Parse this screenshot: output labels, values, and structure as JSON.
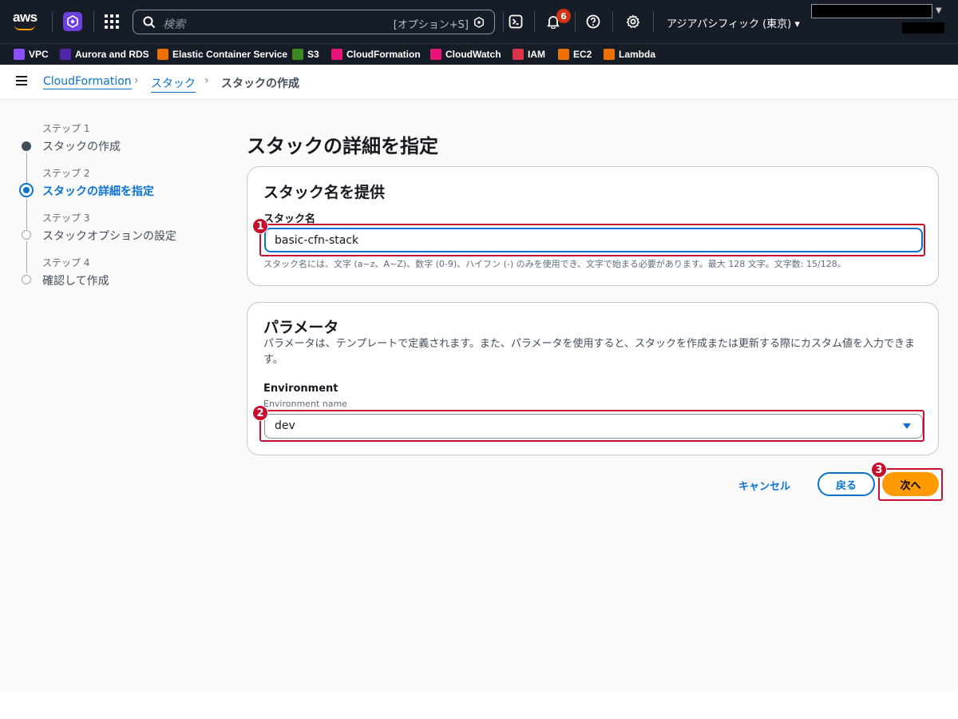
{
  "topbar": {
    "logo_text": "aws",
    "search_placeholder": "検索",
    "search_shortcut": "[オプション+S]",
    "notification_count": "6",
    "region": "アジアパシフィック (東京) ▾"
  },
  "favorites": [
    {
      "label": "VPC",
      "color": "#8c4fff"
    },
    {
      "label": "Aurora and RDS",
      "color": "#4d27a8"
    },
    {
      "label": "Elastic Container Service",
      "color": "#ed7100"
    },
    {
      "label": "S3",
      "color": "#3f8624"
    },
    {
      "label": "CloudFormation",
      "color": "#e7157b"
    },
    {
      "label": "CloudWatch",
      "color": "#e7157b"
    },
    {
      "label": "IAM",
      "color": "#dd344c"
    },
    {
      "label": "EC2",
      "color": "#ed7100"
    },
    {
      "label": "Lambda",
      "color": "#ed7100"
    }
  ],
  "breadcrumb": {
    "items": [
      "CloudFormation",
      "スタック",
      "スタックの作成"
    ]
  },
  "steps": [
    {
      "label": "ステップ 1",
      "title": "スタックの作成",
      "state": "done"
    },
    {
      "label": "ステップ 2",
      "title": "スタックの詳細を指定",
      "state": "active"
    },
    {
      "label": "ステップ 3",
      "title": "スタックオプションの設定",
      "state": "todo"
    },
    {
      "label": "ステップ 4",
      "title": "確認して作成",
      "state": "todo"
    }
  ],
  "page_title": "スタックの詳細を指定",
  "stack_name_card": {
    "heading": "スタック名を提供",
    "field_label": "スタック名",
    "value": "basic-cfn-stack",
    "help": "スタック名には、文字 (a~z、A~Z)、数字 (0-9)、ハイフン (-) のみを使用でき、文字で始まる必要があります。最大 128 文字。文字数:   15/128。"
  },
  "parameters_card": {
    "heading": "パラメータ",
    "description": "パラメータは、テンプレートで定義されます。また、パラメータを使用すると、スタックを作成または更新する際にカスタム値を入力できます。",
    "field_label": "Environment",
    "field_sub": "Environment name",
    "selected": "dev"
  },
  "annotations": [
    "1",
    "2",
    "3"
  ],
  "actions": {
    "cancel": "キャンセル",
    "back": "戻る",
    "next": "次へ"
  },
  "colors": {
    "accent": "#0972d3",
    "primary_button": "#ff9900",
    "highlight": "#c7102e",
    "nav_bg": "#161d26"
  }
}
